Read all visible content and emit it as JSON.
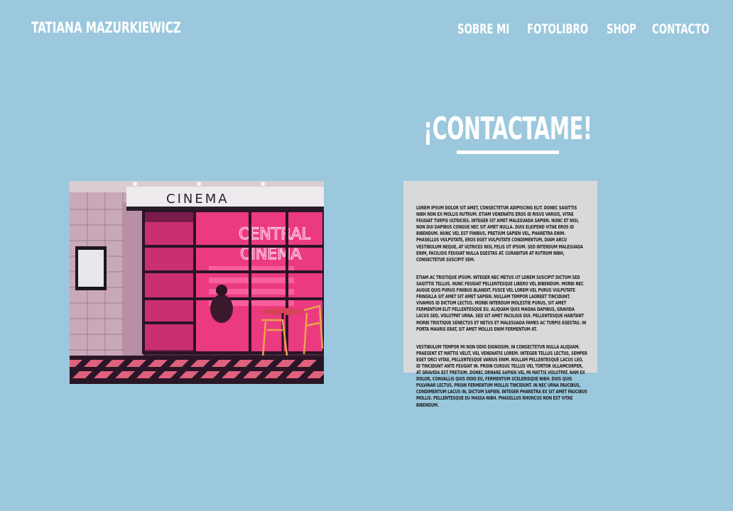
{
  "header": {
    "brand": "TATIANA MAZURKIEWICZ",
    "nav": [
      {
        "label": "SOBRE MI"
      },
      {
        "label": "FOTOLIBRO"
      },
      {
        "label": "SHOP"
      },
      {
        "label": "CONTACTO"
      }
    ]
  },
  "main": {
    "heading": "¡CONTACTAME!",
    "photo": {
      "sign_text": "CINEMA",
      "neon_line1": "CENTRAL",
      "neon_line2": "CINEMA"
    },
    "paragraphs": [
      "Lorem ipsum dolor sit amet, consectetur adipiscing elit. Donec sagittis nibh non ex mollis rutrum. Etiam venenatis eros id risus varius, vitae feugiat turpis ultricies. Integer sit amet malesuada sapien. Nunc et nisi, non dui dapibus congue nec sit amet nulla. Duis eleifend vitae eros id bibendum. Nunc vel est finibus, pretium sapien vel, pharetra enim. Phasellus vulputate, eros eget vulputate condimentum, diam arcu vestibulum neque, at ultrices nisl felis ut ipsum. Sed interdum malesuada enim, facilisis feugiat nulla egestas at. Curabitur at rutrum nibh, consectetur suscipit sem.",
      "Etiam ac tristique ipsum. Integer nec metus ut lorem suscipit dictum sed sagittis tellus. Nunc feugiat pellentesque libero vel bibendum. Morbi nec augue quis purus finibus blandit. Fusce vel lorem vel purus vulputate fringilla sit amet sit amet sapien. Nullam tempor laoreet tincidunt. Vivamus id dictum lectus. Morbi interdum molestie purus, sit amet fermentum elit pellentesque eu. Aliquam quis magna dapibus, gravida lacus sed, volutpat urna. Sed sit amet facilisis dui. Pellentesque habitant morbi tristique senectus et netus et malesuada fames ac turpis egestas. In porta mauris erat, sit amet mollis enim fermentum at.",
      "Vestibulum tempor mi non odio dignissim, in consectetur nulla aliquam. Praesent et mattis velit, vel venenatis lorem. Integer tellus lectus, semper eget orci vitae, pellentesque varius enim. Nullam pellentesque lacus leo, id tincidunt ante feugiat in. Proin cursus tellus vel tortor ullamcorper, at gravida est pretium. Donec ornare sapien vel mi mattis volutpat. Nam ex dolor, convallis quis odio eu, fermentum scelerisque nibh. Duis quis pulvinar lectus. Proin fermentum mollis tincidunt. In nec urna faucibus, condimentum lacus in, dictum sapien. Integer pharetra ex sit amet faucibus mollis. Pellentesque eu massa nibh. Phasellus rhoncus non est vitae bibendum."
    ]
  },
  "colors": {
    "background": "#9bc8dd",
    "text": "#ffffff",
    "card": "#d9d9d9",
    "neon": "#ff3f8a"
  }
}
